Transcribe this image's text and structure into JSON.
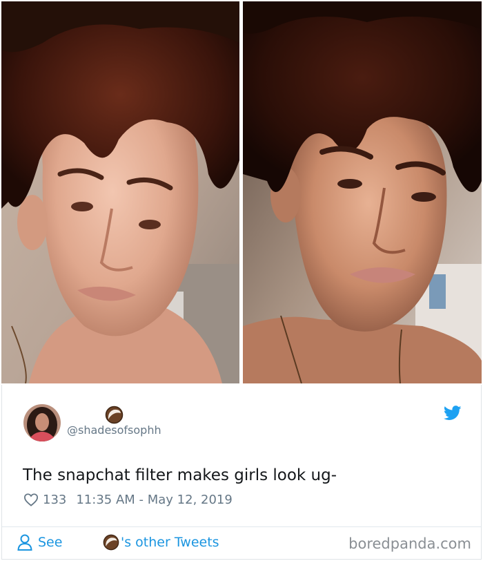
{
  "tweet": {
    "handle": "@shadesofsophh",
    "text": "The snapchat filter makes girls look ug-",
    "likes": "133",
    "timestamp": "11:35 AM - May 12, 2019",
    "name_icon": "coconut-emoji-icon"
  },
  "footer": {
    "see_label": "See",
    "other_tweets_label": "'s other Tweets",
    "watermark": "boredpanda.com"
  },
  "colors": {
    "link": "#1b95e0",
    "muted": "#657786",
    "text": "#14171a",
    "twitter_blue": "#1da1f2"
  }
}
